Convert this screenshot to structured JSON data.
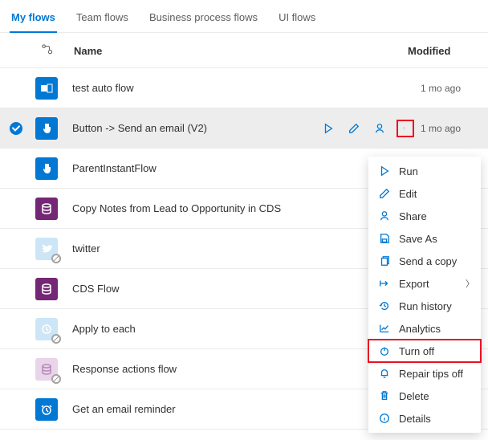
{
  "tabs": {
    "myflows": "My flows",
    "team": "Team flows",
    "bpf": "Business process flows",
    "ui": "UI flows"
  },
  "header": {
    "name": "Name",
    "modified": "Modified"
  },
  "rows": {
    "r0": {
      "name": "test auto flow",
      "modified": "1 mo ago"
    },
    "r1": {
      "name": "Button -> Send an email (V2)",
      "modified": "1 mo ago"
    },
    "r2": {
      "name": "ParentInstantFlow",
      "modified": ""
    },
    "r3": {
      "name": "Copy Notes from Lead to Opportunity in CDS",
      "modified": ""
    },
    "r4": {
      "name": "twitter",
      "modified": ""
    },
    "r5": {
      "name": "CDS Flow",
      "modified": ""
    },
    "r6": {
      "name": "Apply to each",
      "modified": ""
    },
    "r7": {
      "name": "Response actions flow",
      "modified": ""
    },
    "r8": {
      "name": "Get an email reminder",
      "modified": ""
    }
  },
  "menu": {
    "run": "Run",
    "edit": "Edit",
    "share": "Share",
    "saveas": "Save As",
    "sendcopy": "Send a copy",
    "export": "Export",
    "history": "Run history",
    "analytics": "Analytics",
    "turnoff": "Turn off",
    "repair": "Repair tips off",
    "delete": "Delete",
    "details": "Details"
  }
}
